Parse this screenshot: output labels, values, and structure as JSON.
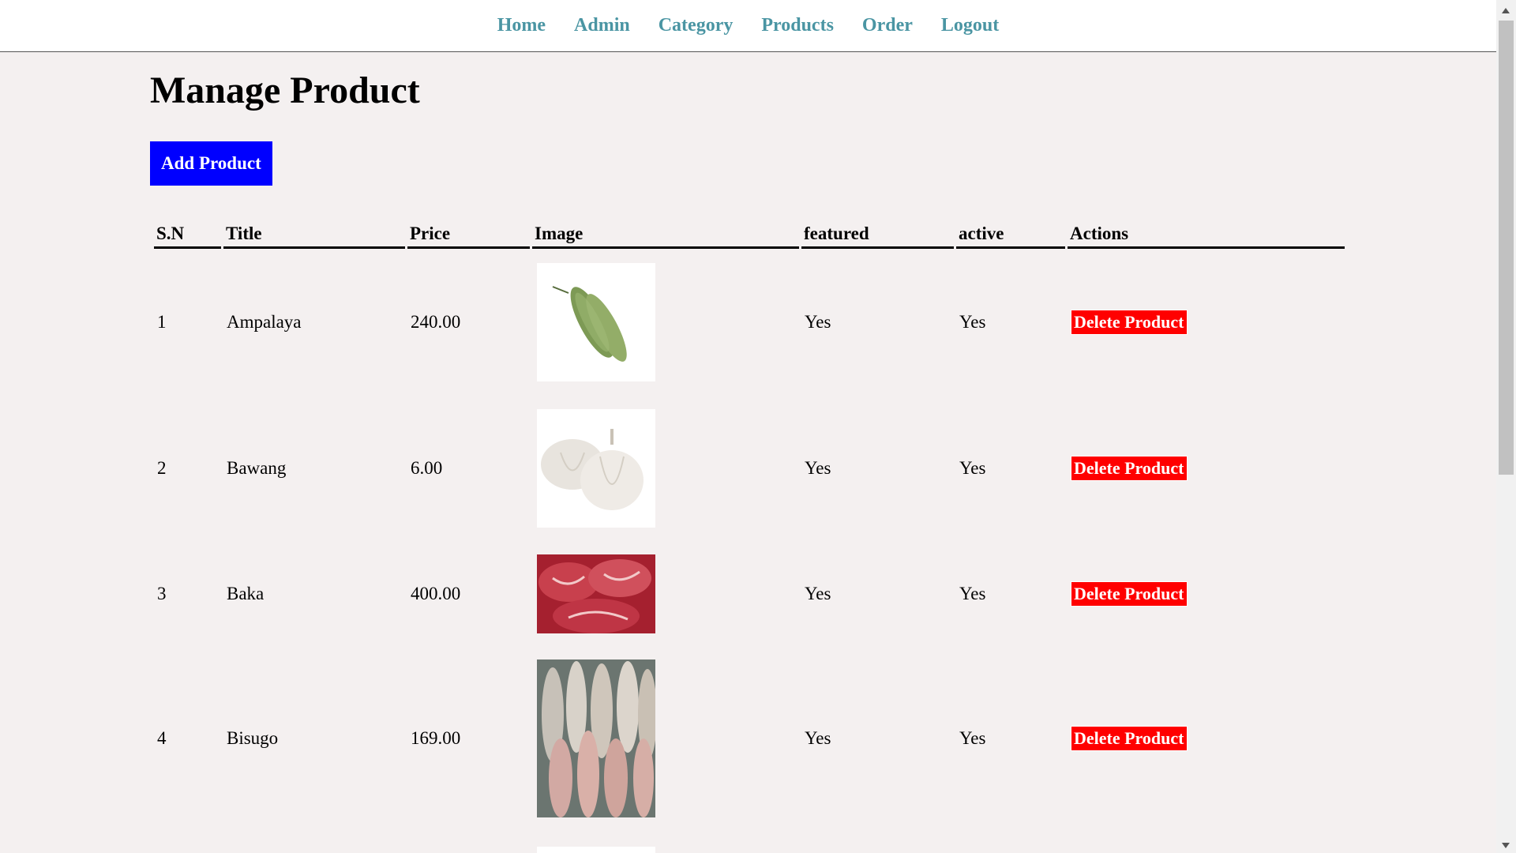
{
  "nav": {
    "items": [
      {
        "label": "Home"
      },
      {
        "label": "Admin"
      },
      {
        "label": "Category"
      },
      {
        "label": "Products"
      },
      {
        "label": "Order"
      },
      {
        "label": "Logout"
      }
    ]
  },
  "page": {
    "title": "Manage Product",
    "add_button": "Add Product"
  },
  "table": {
    "headers": [
      "S.N",
      "Title",
      "Price",
      "Image",
      "featured",
      "active",
      "Actions"
    ],
    "rows": [
      {
        "sn": "1",
        "title": "Ampalaya",
        "price": "240.00",
        "image": "ampalaya-image",
        "featured": "Yes",
        "active": "Yes",
        "action": "Delete Product"
      },
      {
        "sn": "2",
        "title": "Bawang",
        "price": "6.00",
        "image": "garlic-image",
        "featured": "Yes",
        "active": "Yes",
        "action": "Delete Product"
      },
      {
        "sn": "3",
        "title": "Baka",
        "price": "400.00",
        "image": "beef-image",
        "featured": "Yes",
        "active": "Yes",
        "action": "Delete Product"
      },
      {
        "sn": "4",
        "title": "Bisugo",
        "price": "169.00",
        "image": "fish-image",
        "featured": "Yes",
        "active": "Yes",
        "action": "Delete Product"
      }
    ]
  },
  "colors": {
    "nav_link": "#4a95a3",
    "add_button_bg": "#0000ff",
    "delete_button_bg": "#ff0000",
    "page_bg": "#f4f0f0"
  }
}
